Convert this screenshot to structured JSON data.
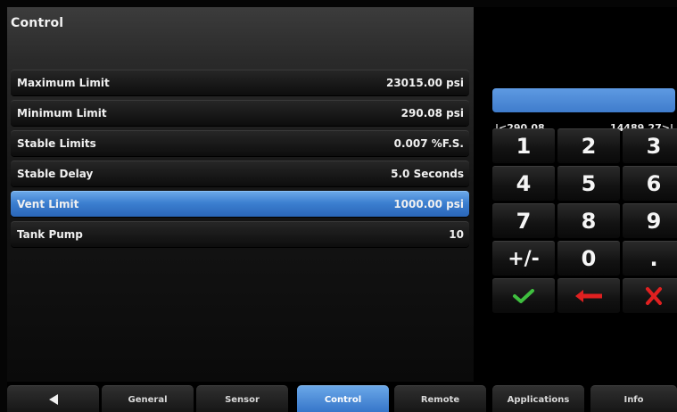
{
  "header": {
    "title": "Control"
  },
  "settings": [
    {
      "label": "Maximum Limit",
      "value": "23015.00 psi"
    },
    {
      "label": "Minimum Limit",
      "value": "290.08 psi"
    },
    {
      "label": "Stable Limits",
      "value": "0.007 %F.S."
    },
    {
      "label": "Stable Delay",
      "value": "5.0 Seconds"
    },
    {
      "label": "Vent Limit",
      "value": "1000.00 psi",
      "selected": true
    },
    {
      "label": "Tank Pump",
      "value": "10"
    }
  ],
  "keypad": {
    "entry_value": "",
    "range_min": "|<290.08",
    "range_max": "14489.27>|",
    "keys": [
      "1",
      "2",
      "3",
      "4",
      "5",
      "6",
      "7",
      "8",
      "9",
      "+/-",
      "0",
      "."
    ],
    "action_icons": [
      "check-icon",
      "backspace-arrow-icon",
      "x-cancel-icon"
    ],
    "colors": {
      "check": "#3fbf3f",
      "backspace": "#e02020",
      "cancel": "#e02020"
    }
  },
  "tabs": [
    {
      "label": "",
      "icon": "back-triangle-icon"
    },
    {
      "label": "General"
    },
    {
      "label": "Sensor"
    },
    {
      "label": "Control",
      "active": true
    },
    {
      "label": "Remote"
    },
    {
      "label": "Applications"
    },
    {
      "label": "Info"
    }
  ],
  "colors": {
    "accent": "#3c7fd0",
    "background": "#000000"
  }
}
